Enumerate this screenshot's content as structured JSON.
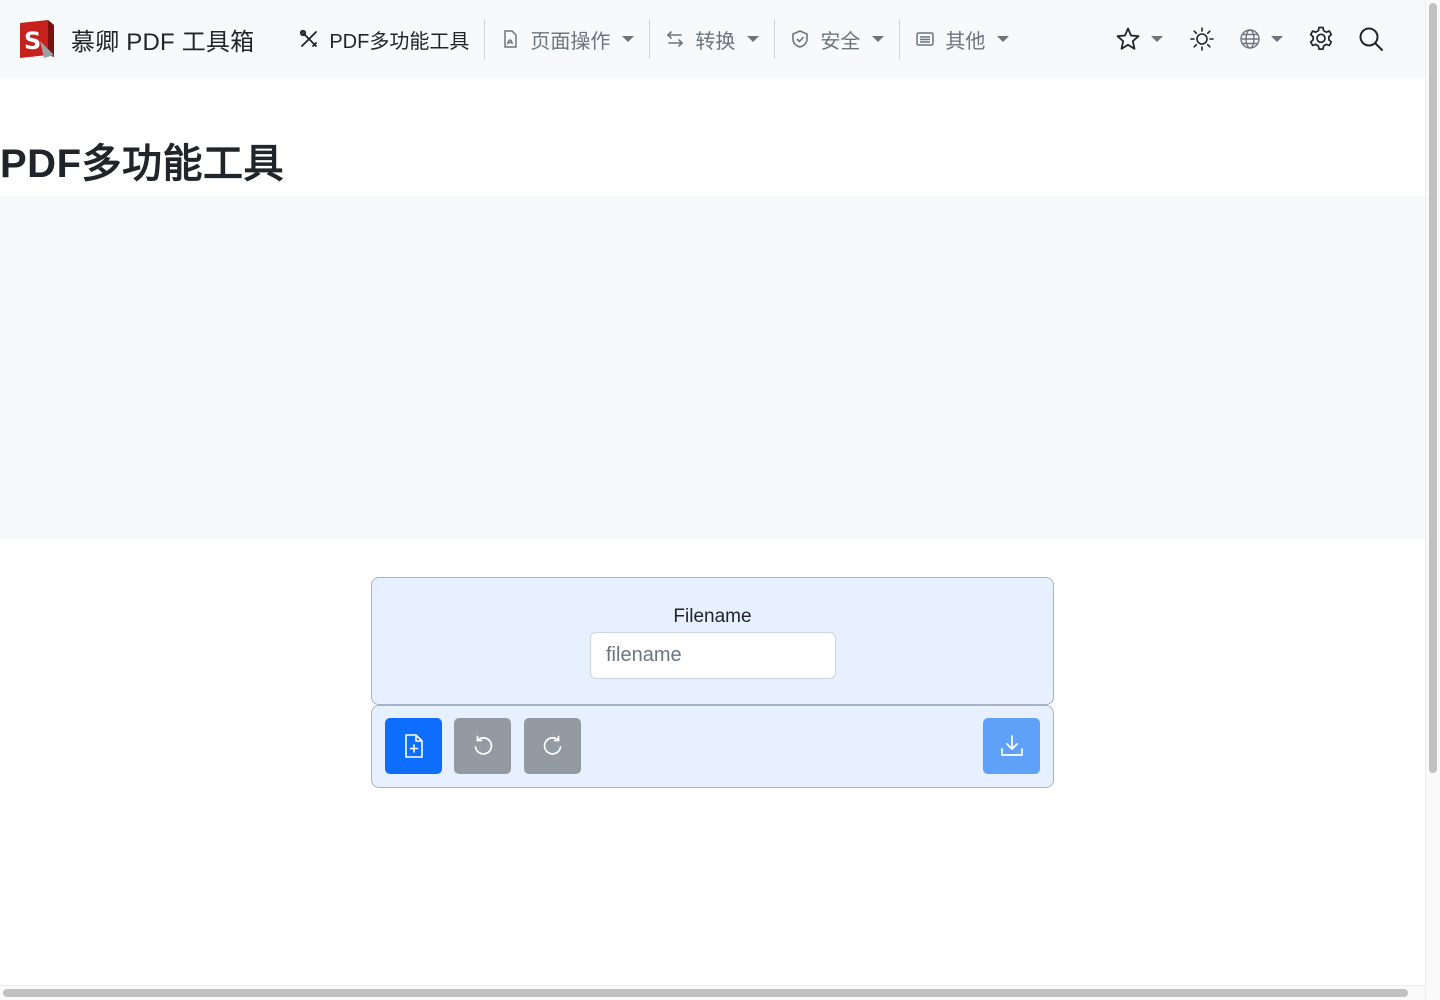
{
  "brand": {
    "name": "慕卿 PDF 工具箱"
  },
  "nav": {
    "items": [
      {
        "label": "PDF多功能工具",
        "icon": "tools-icon"
      },
      {
        "label": "页面操作",
        "icon": "file-pdf-icon"
      },
      {
        "label": "转换",
        "icon": "arrows-exchange-icon"
      },
      {
        "label": "安全",
        "icon": "shield-check-icon"
      },
      {
        "label": "其他",
        "icon": "card-list-icon"
      }
    ],
    "right_icons": [
      "star-icon",
      "sun-icon",
      "globe-icon",
      "gear-icon",
      "search-icon"
    ]
  },
  "page": {
    "title": "PDF多功能工具"
  },
  "form": {
    "filename_label": "Filename",
    "filename_placeholder": "filename",
    "filename_value": ""
  },
  "actions": [
    "add-file-icon",
    "rotate-left-icon",
    "rotate-right-icon",
    "download-icon"
  ],
  "colors": {
    "primary": "#0d6efd",
    "secondary": "#939aa2",
    "download": "#5fa0f8",
    "card_bg": "#e7f0fe",
    "navbar_bg": "#f8f9fa"
  }
}
